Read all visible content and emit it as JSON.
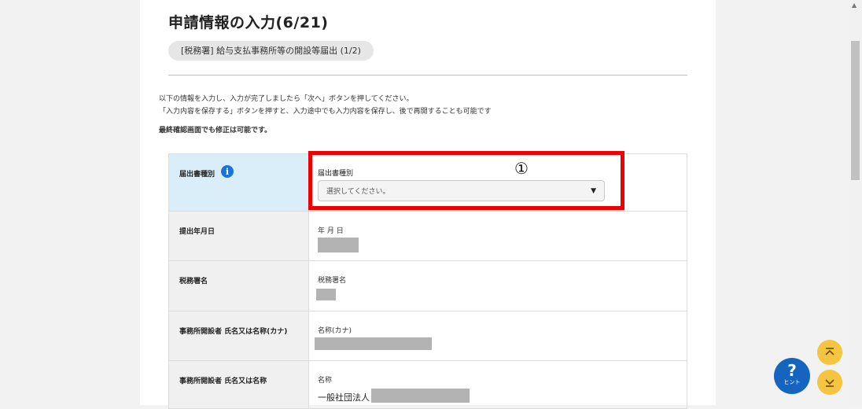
{
  "header": {
    "title": "申請情報の入力(6/21)",
    "step": "[税務署] 給与支払事務所等の開設等届出 (1/2)"
  },
  "intro": {
    "line1": "以下の情報を入力し、入力が完了しましたら「次へ」ボタンを押してください。",
    "line2": "「入力内容を保存する」ボタンを押すと、入力途中でも入力内容を保存し、後で再開することも可能です",
    "line3": "最終確認画面でも修正は可能です。"
  },
  "form": {
    "rows": [
      {
        "label": "届出書種別",
        "field_label": "届出書種別",
        "select_value": "選択してください。"
      },
      {
        "label": "提出年月日",
        "field_label": "年 月 日"
      },
      {
        "label": "税務署名",
        "field_label": "税務署名"
      },
      {
        "label": "事務所開設者 氏名又は名称(カナ)",
        "field_label": "名称(カナ)"
      },
      {
        "label": "事務所開設者 氏名又は名称",
        "field_label": "名称",
        "value_prefix": "一般社団法人"
      }
    ]
  },
  "annotation": {
    "marker": "①",
    "color": "#ee0000"
  },
  "hint": {
    "symbol": "?",
    "label": "ヒント"
  },
  "icons": {
    "info": "info-icon",
    "caret": "caret-down-icon",
    "to_top": "double-chevron-up-icon",
    "to_bottom": "chevron-down-icon"
  },
  "colors": {
    "accent": "#1565c0",
    "active_row": "#daeefa",
    "scroll_buttons": "#f5c542"
  }
}
